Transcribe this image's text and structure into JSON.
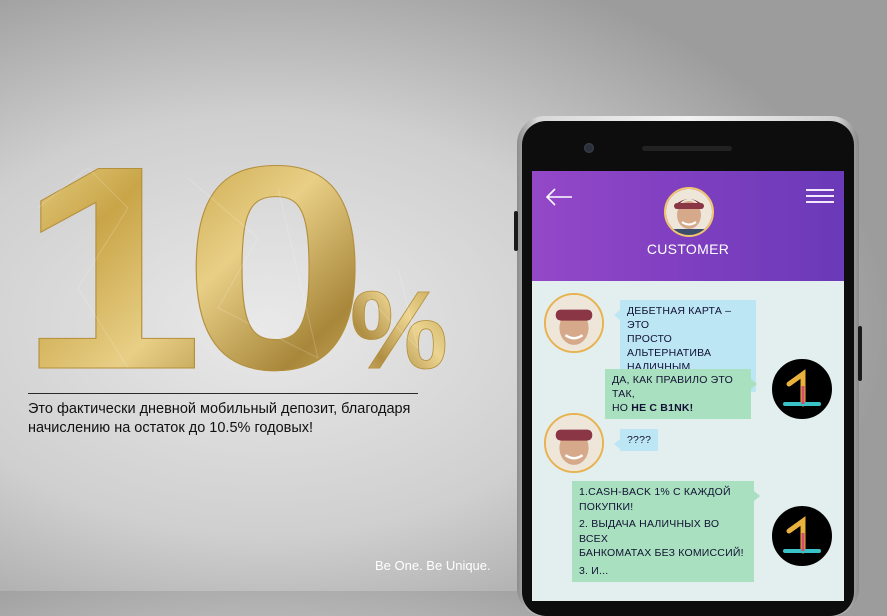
{
  "headline": {
    "number": "10",
    "percent": "%"
  },
  "description": {
    "line1": "Это фактически дневной мобильный депозит, благодаря",
    "line2": "начислению на остаток до 10.5% годовых!"
  },
  "slogan": "Be One. Be Unique.",
  "phone": {
    "contact_name": "CUSTOMER",
    "icons": {
      "back": "arrow-left-icon",
      "menu": "hamburger-menu-icon"
    },
    "messages": [
      {
        "sender": "customer",
        "lines": [
          "ДЕБЕТНАЯ КАРТА – ЭТО",
          "ПРОСТО АЛЬТЕРНАТИВА",
          "НАЛИЧНЫМ ДЕНЬГАМ..."
        ]
      },
      {
        "sender": "bank",
        "line1": "ДА, КАК ПРАВИЛО ЭТО ТАК,",
        "line2_prefix": "НО ",
        "line2_bold": "НЕ С B1NK!"
      },
      {
        "sender": "customer",
        "lines": [
          "????"
        ]
      },
      {
        "sender": "bank",
        "lines": [
          "1.CASH-BACK 1% С КАЖДОЙ",
          "ПОКУПКИ!",
          "2. ВЫДАЧА НАЛИЧНЫХ ВО ВСЕХ",
          "БАНКОМАТАХ БЕЗ КОМИССИЙ!",
          "3. И..."
        ]
      }
    ]
  },
  "colors": {
    "gold": "#c9a54a",
    "header_purple": "#8a43c4",
    "bubble_blue": "#bde6f5",
    "bubble_green": "#a9e0bf"
  }
}
